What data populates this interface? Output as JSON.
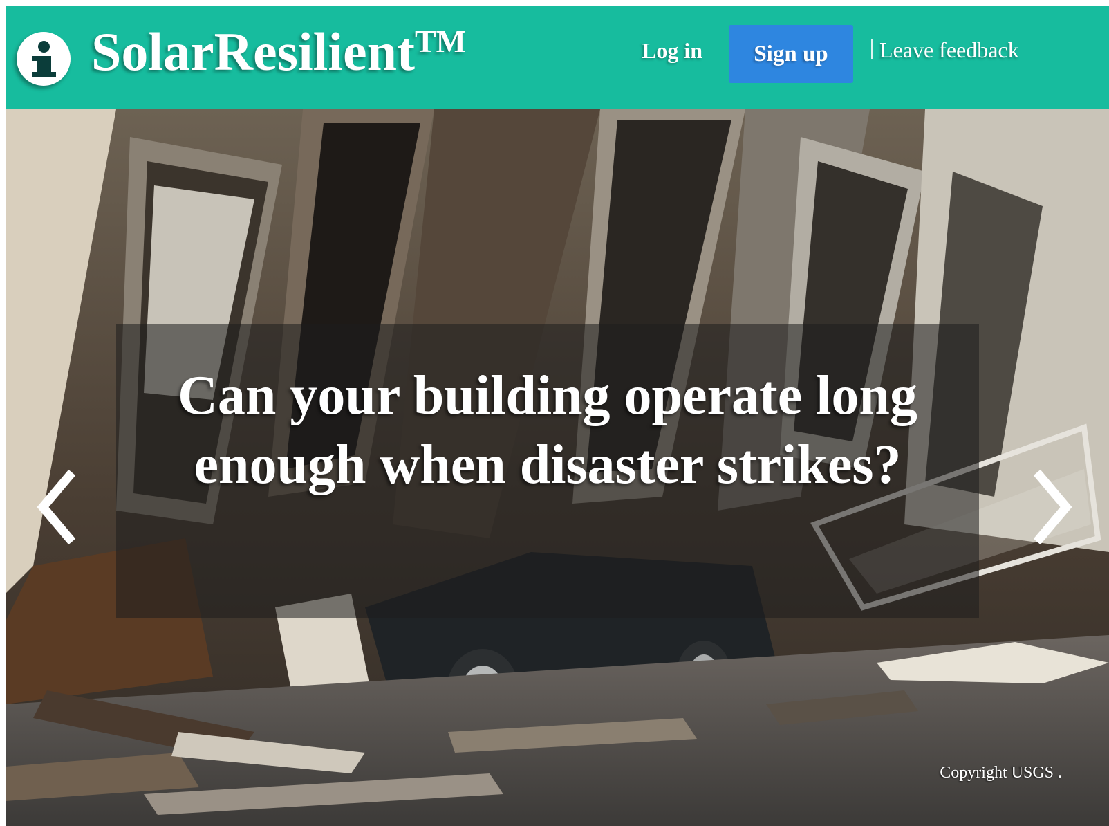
{
  "header": {
    "brand_name": "SolarResilient",
    "brand_mark": "TM",
    "logo_icon": "info-icon",
    "login_label": "Log in",
    "signup_label": "Sign up",
    "feedback_label": "Leave feedback",
    "background_color": "#17bc9e",
    "signup_color": "#2e86e0"
  },
  "carousel": {
    "headline": "Can your building operate long enough when disaster strikes?",
    "prev_icon": "chevron-left-icon",
    "next_icon": "chevron-right-icon",
    "image_credit": "Copyright USGS ."
  }
}
